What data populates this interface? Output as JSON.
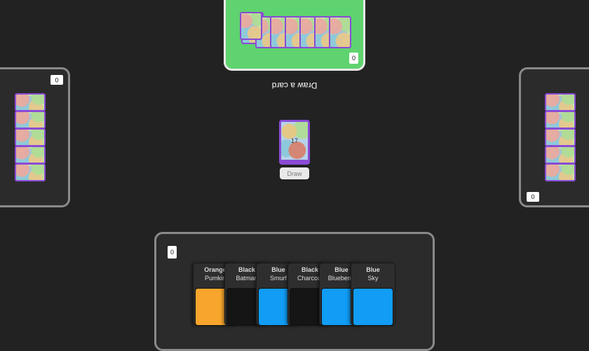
{
  "top_player": {
    "card_count_label": "0",
    "hidden_cards": 7
  },
  "left_player": {
    "card_count_label": "0",
    "hidden_cards": 5
  },
  "right_player": {
    "card_count_label": "0",
    "hidden_cards": 5
  },
  "bottom_player": {
    "card_count_label": "0",
    "hand": [
      {
        "name": "Orange",
        "shade": "Pumkin",
        "color": "#f7a52c"
      },
      {
        "name": "Black",
        "shade": "Batman",
        "color": "#151515"
      },
      {
        "name": "Blue",
        "shade": "Smurf",
        "color": "#119cf5"
      },
      {
        "name": "Black",
        "shade": "Charcoal",
        "color": "#151515"
      },
      {
        "name": "Blue",
        "shade": "Blueberry",
        "color": "#119cf5"
      },
      {
        "name": "Blue",
        "shade": "Sky",
        "color": "#119cf5"
      }
    ]
  },
  "status_text": "Draw a card",
  "draw_pile": {
    "count": "17",
    "button_label": "Draw"
  },
  "colors": {
    "active_panel": "#5fd36f",
    "card_border": "#8a4bd6",
    "background": "#222222"
  }
}
